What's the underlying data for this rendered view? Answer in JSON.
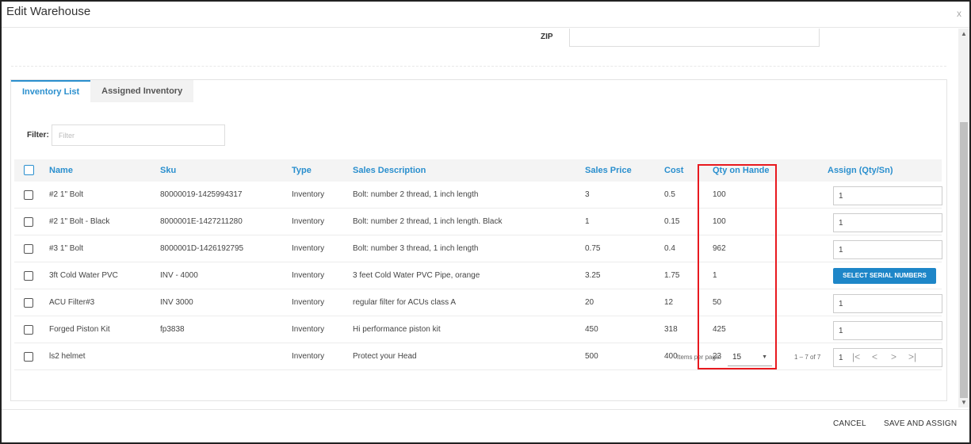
{
  "dialog": {
    "title": "Edit Warehouse",
    "close_icon": "x"
  },
  "zip": {
    "label": "ZIP",
    "value": ""
  },
  "tabs": [
    {
      "label": "Inventory List",
      "active": true
    },
    {
      "label": "Assigned Inventory",
      "active": false
    }
  ],
  "filter": {
    "label": "Filter:",
    "placeholder": "Filter",
    "value": ""
  },
  "table": {
    "columns": [
      "Name",
      "Sku",
      "Type",
      "Sales Description",
      "Sales Price",
      "Cost",
      "Qty on Hande",
      "Assign (Qty/Sn)"
    ],
    "rows": [
      {
        "name": "#2 1\" Bolt",
        "sku": "80000019-1425994317",
        "type": "Inventory",
        "description": "Bolt: number 2 thread, 1 inch length",
        "price": "3",
        "cost": "0.5",
        "qty": "100",
        "assign": "1"
      },
      {
        "name": "#2 1\" Bolt - Black",
        "sku": "8000001E-1427211280",
        "type": "Inventory",
        "description": "Bolt: number 2 thread, 1 inch length. Black",
        "price": "1",
        "cost": "0.15",
        "qty": "100",
        "assign": "1"
      },
      {
        "name": "#3 1\" Bolt",
        "sku": "8000001D-1426192795",
        "type": "Inventory",
        "description": "Bolt: number 3 thread, 1 inch length",
        "price": "0.75",
        "cost": "0.4",
        "qty": "962",
        "assign": "1"
      },
      {
        "name": "3ft Cold Water PVC",
        "sku": "INV - 4000",
        "type": "Inventory",
        "description": "3 feet Cold Water PVC Pipe, orange",
        "price": "3.25",
        "cost": "1.75",
        "qty": "1",
        "assign_button": "SELECT SERIAL NUMBERS"
      },
      {
        "name": "ACU Filter#3",
        "sku": "INV 3000",
        "type": "Inventory",
        "description": "regular filter for ACUs class A",
        "price": "20",
        "cost": "12",
        "qty": "50",
        "assign": "1"
      },
      {
        "name": "Forged Piston Kit",
        "sku": "fp3838",
        "type": "Inventory",
        "description": "Hi performance piston kit",
        "price": "450",
        "cost": "318",
        "qty": "425",
        "assign": "1"
      },
      {
        "name": "ls2 helmet",
        "sku": "",
        "type": "Inventory",
        "description": "Protect your Head",
        "price": "500",
        "cost": "400",
        "qty": "23",
        "assign": "1"
      }
    ]
  },
  "pager": {
    "items_per_page_label": "Items per page:",
    "items_per_page": "15",
    "range": "1 – 7 of 7",
    "first_icon": "|<",
    "prev_icon": "<",
    "next_icon": ">",
    "last_icon": ">|"
  },
  "footer": {
    "cancel": "CANCEL",
    "save": "SAVE AND ASSIGN"
  },
  "colors": {
    "accent": "#2a8fce",
    "button": "#1e86c8",
    "highlight": "#e8191f"
  },
  "icons": {
    "close": "close-icon",
    "checkbox": "checkbox-icon",
    "caret": "chevron-down-icon"
  }
}
